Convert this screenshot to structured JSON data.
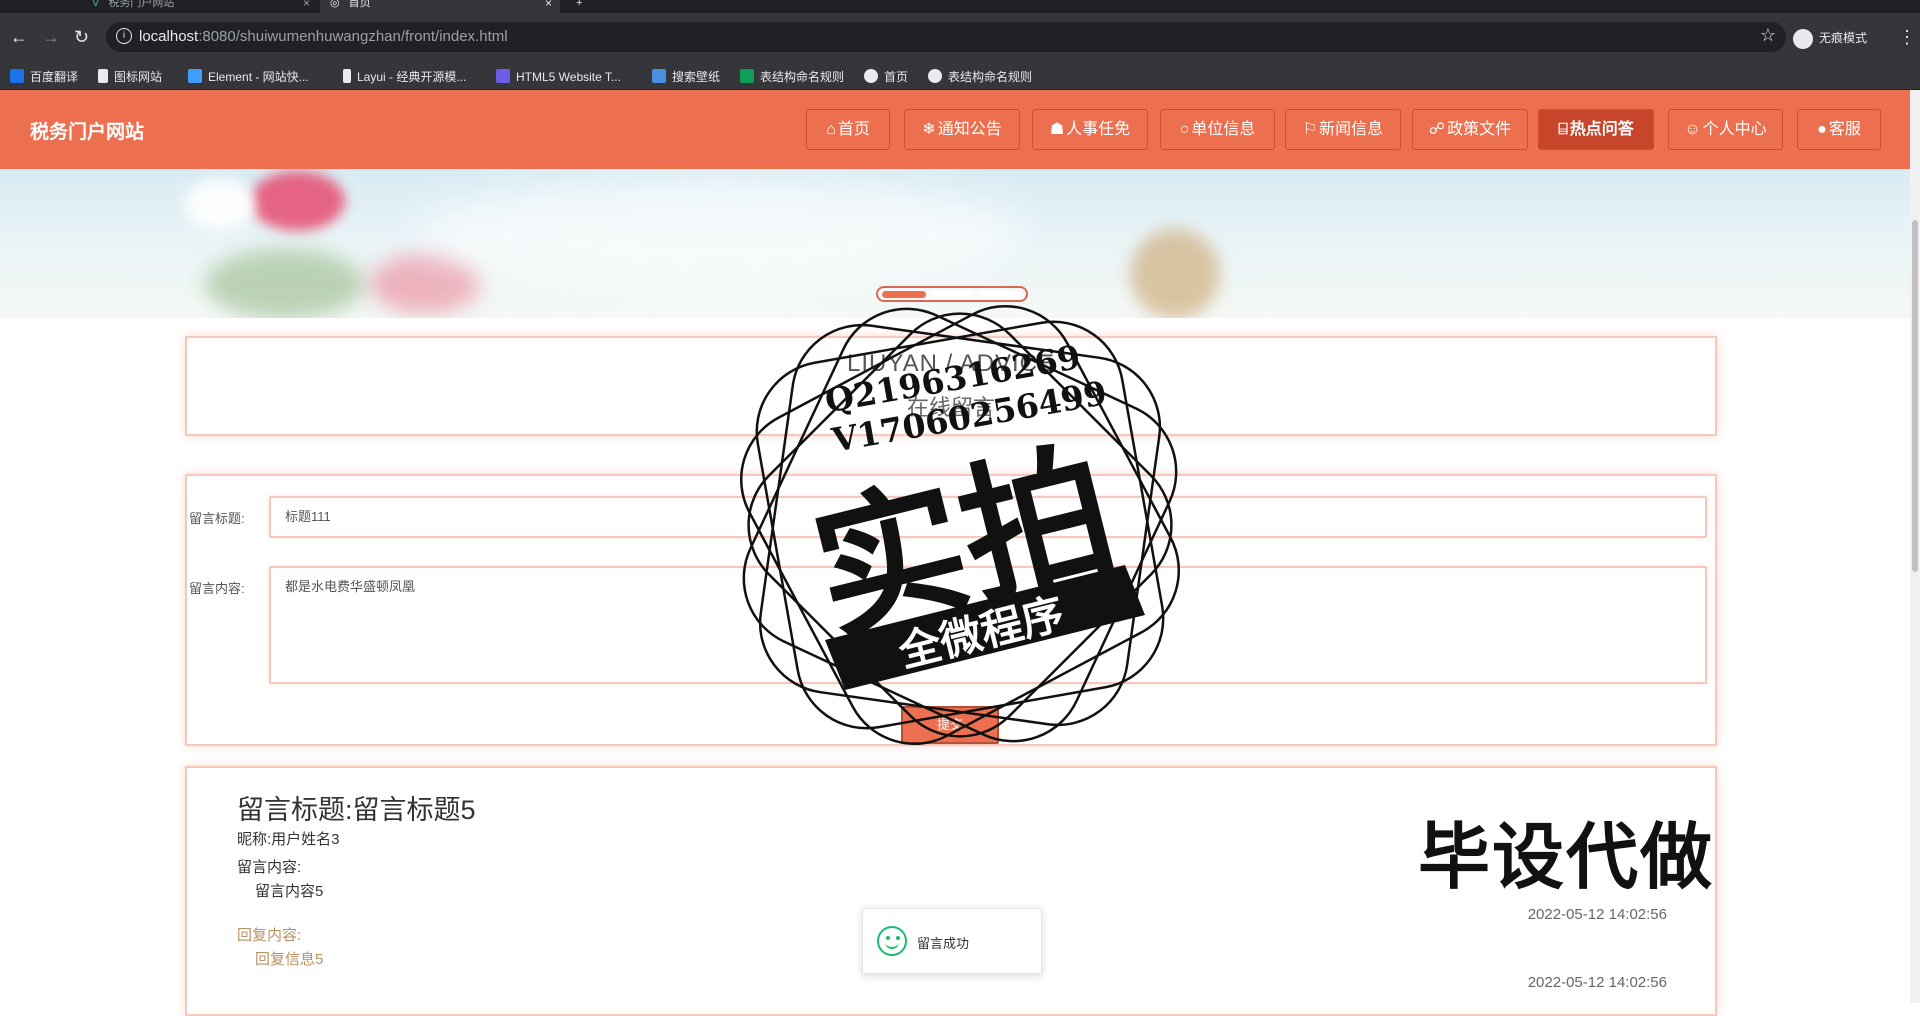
{
  "browser": {
    "tabs": [
      {
        "title": "税务门户网站",
        "active": false
      },
      {
        "title": "首页",
        "active": true
      }
    ],
    "url_host": "localhost",
    "url_rest": ":8080/shuiwumenhuwangzhan/front/index.html",
    "incognito_label": "无痕模式",
    "bookmarks": [
      "百度翻译",
      "图标网站",
      "Element - 网站快...",
      "Layui - 经典开源模...",
      "HTML5 Website T...",
      "搜索壁纸",
      "表结构命名规则",
      "首页",
      "表结构命名规则"
    ]
  },
  "site": {
    "logo": "税务门户网站",
    "nav": [
      {
        "icon": "⌂",
        "label": "首页",
        "active": false
      },
      {
        "icon": "❄",
        "label": "通知公告",
        "active": false
      },
      {
        "icon": "☗",
        "label": "人事任免",
        "active": false
      },
      {
        "icon": "○",
        "label": "单位信息",
        "active": false
      },
      {
        "icon": "⚐",
        "label": "新闻信息",
        "active": false
      },
      {
        "icon": "☍",
        "label": "政策文件",
        "active": false
      },
      {
        "icon": "⌸",
        "label": "热点问答",
        "active": true
      },
      {
        "icon": "☺",
        "label": "个人中心",
        "active": false
      },
      {
        "icon": "●",
        "label": "客服",
        "active": false
      }
    ],
    "accent_color": "#ec6f4f"
  },
  "banner": {
    "slide_count": 3,
    "active_slide": 1
  },
  "section": {
    "title_en": "LIUYAN / ADVICE",
    "title_cn": "在线留言"
  },
  "form": {
    "title_label": "留言标题:",
    "title_value": "标题111",
    "content_label": "留言内容:",
    "content_value": "都是水电费华盛顿凤凰",
    "submit_label": "提交"
  },
  "messages": [
    {
      "title": "留言标题:留言标题5",
      "nickname": "昵称:用户姓名3",
      "content_label": "留言内容:",
      "content": "留言内容5",
      "reply_label": "回复内容:",
      "reply": "回复信息5",
      "time": "2022-05-12 14:02:56",
      "reply_time": "2022-05-12 14:02:56"
    }
  ],
  "toast": {
    "message": "留言成功"
  },
  "watermark": {
    "stamp_big": "实拍",
    "stamp_ribbon": "全微程序",
    "stamp_q": "Q2196316269",
    "stamp_v": "V17060256499",
    "corner_text": "毕设代做"
  }
}
